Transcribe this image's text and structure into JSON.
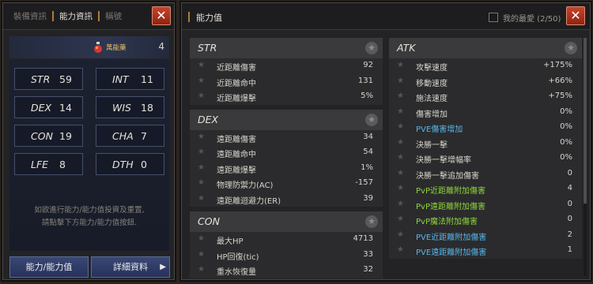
{
  "left": {
    "tabs": [
      "裝備資訊",
      "能力資訊",
      "稱號"
    ],
    "active_tab": 1,
    "elixir": {
      "label": "萬能藥",
      "count": "4"
    },
    "stats": [
      {
        "name": "STR",
        "value": "59"
      },
      {
        "name": "INT",
        "value": "11"
      },
      {
        "name": "DEX",
        "value": "14"
      },
      {
        "name": "WIS",
        "value": "18"
      },
      {
        "name": "CON",
        "value": "19"
      },
      {
        "name": "CHA",
        "value": "7"
      },
      {
        "name": "LFE",
        "value": "8"
      },
      {
        "name": "DTH",
        "value": "0"
      }
    ],
    "hint_line1": "如欲進行能力/能力值投資及重置,",
    "hint_line2": "請點擊下方能力/能力值按鈕.",
    "btn_stats": "能力/能力值",
    "btn_details": "詳細資料"
  },
  "right": {
    "title": "能力值",
    "favorite_label": "我的最愛 (2/50)",
    "col_left": [
      {
        "title": "STR",
        "rows": [
          {
            "label": "近距離傷害",
            "value": "92",
            "color": "normal"
          },
          {
            "label": "近距離命中",
            "value": "131",
            "color": "normal"
          },
          {
            "label": "近距離爆擊",
            "value": "5%",
            "color": "normal"
          }
        ]
      },
      {
        "title": "DEX",
        "rows": [
          {
            "label": "遠距離傷害",
            "value": "34",
            "color": "normal"
          },
          {
            "label": "遠距離命中",
            "value": "54",
            "color": "normal"
          },
          {
            "label": "遠距離爆擊",
            "value": "1%",
            "color": "normal"
          },
          {
            "label": "物理防禦力(AC)",
            "value": "-157",
            "color": "normal"
          },
          {
            "label": "遠距離迴避力(ER)",
            "value": "39",
            "color": "normal"
          }
        ]
      },
      {
        "title": "CON",
        "rows": [
          {
            "label": "最大HP",
            "value": "4713",
            "color": "normal"
          },
          {
            "label": "HP回復(tic)",
            "value": "33",
            "color": "normal"
          },
          {
            "label": "重水恢復量",
            "value": "32",
            "color": "normal"
          }
        ]
      }
    ],
    "col_right": [
      {
        "title": "ATK",
        "rows": [
          {
            "label": "攻擊速度",
            "value": "+175%",
            "color": "normal"
          },
          {
            "label": "移動速度",
            "value": "+66%",
            "color": "normal"
          },
          {
            "label": "施法速度",
            "value": "+75%",
            "color": "normal"
          },
          {
            "label": "傷害增加",
            "value": "0%",
            "color": "normal"
          },
          {
            "label": "PVE傷害增加",
            "value": "0%",
            "color": "blue"
          },
          {
            "label": "決勝一擊",
            "value": "0%",
            "color": "normal"
          },
          {
            "label": "決勝一擊增幅率",
            "value": "0%",
            "color": "normal"
          },
          {
            "label": "決勝一擊追加傷害",
            "value": "0",
            "color": "normal"
          },
          {
            "label": "PvP近距離附加傷害",
            "value": "4",
            "color": "green"
          },
          {
            "label": "PvP遠距離附加傷害",
            "value": "0",
            "color": "green"
          },
          {
            "label": "PvP魔法附加傷害",
            "value": "0",
            "color": "green"
          },
          {
            "label": "PVE近距離附加傷害",
            "value": "2",
            "color": "blue"
          },
          {
            "label": "PVE遠距離附加傷害",
            "value": "1",
            "color": "blue"
          }
        ]
      }
    ]
  },
  "icons": {
    "close": "close-icon",
    "star": "star-icon",
    "potion": "potion-icon",
    "arrow": "arrow-right-icon"
  },
  "colors": {
    "accent": "#b07a3a",
    "close": "#c8432c",
    "green": "#8ed63a",
    "blue": "#56b6ea"
  }
}
